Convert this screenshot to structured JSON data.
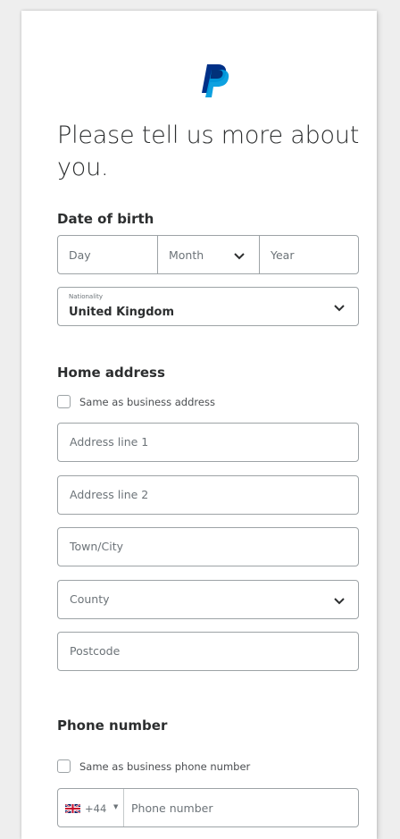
{
  "title": "Please tell us more about you.",
  "colors": {
    "brand_dark": "#003087",
    "brand_light": "#009cde",
    "text": "#2c2e2f",
    "border": "#9da3a6"
  },
  "logo": {
    "icon": "paypal-logo-icon"
  },
  "dob": {
    "heading": "Date of birth",
    "day_placeholder": "Day",
    "month_placeholder": "Month",
    "year_placeholder": "Year"
  },
  "nationality": {
    "label": "Nationality",
    "value": "United Kingdom"
  },
  "home_address": {
    "heading": "Home address",
    "same_as_business_label": "Same as business address",
    "same_as_business_checked": false,
    "line1_placeholder": "Address line 1",
    "line2_placeholder": "Address line 2",
    "city_placeholder": "Town/City",
    "county_placeholder": "County",
    "postcode_placeholder": "Postcode"
  },
  "phone": {
    "heading": "Phone number",
    "same_as_business_label": "Same as business phone number",
    "same_as_business_checked": false,
    "country_flag": "uk-flag-icon",
    "country_code": "+44",
    "number_placeholder": "Phone number"
  }
}
